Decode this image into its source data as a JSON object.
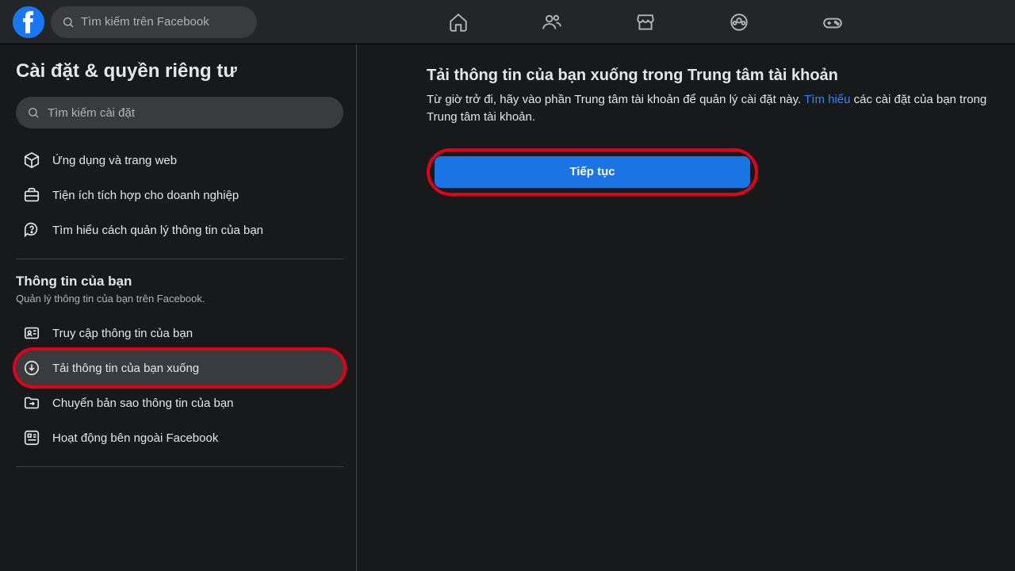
{
  "header": {
    "search_placeholder": "Tìm kiếm trên Facebook"
  },
  "sidebar": {
    "title": "Cài đặt & quyền riêng tư",
    "search_placeholder": "Tìm kiếm cài đặt",
    "top_items": {
      "apps": "Ứng dụng và trang web",
      "biz": "Tiện ích tích hợp cho doanh nghiệp",
      "learn": "Tìm hiểu cách quản lý thông tin của bạn"
    },
    "section2": {
      "title": "Thông tin của bạn",
      "sub": "Quản lý thông tin của bạn trên Facebook.",
      "items": {
        "access": "Truy cập thông tin của bạn",
        "download": "Tải thông tin của bạn xuống",
        "transfer": "Chuyển bản sao thông tin của bạn",
        "offfb": "Hoạt động bên ngoài Facebook"
      }
    }
  },
  "main": {
    "title": "Tải thông tin của bạn xuống trong Trung tâm tài khoản",
    "body_a": "Từ giờ trở đi, hãy vào phần Trung tâm tài khoản để quản lý cài đặt này. ",
    "body_link": "Tìm hiểu",
    "body_b": " các cài đặt của bạn trong Trung tâm tài khoản.",
    "cta": "Tiếp tục"
  }
}
